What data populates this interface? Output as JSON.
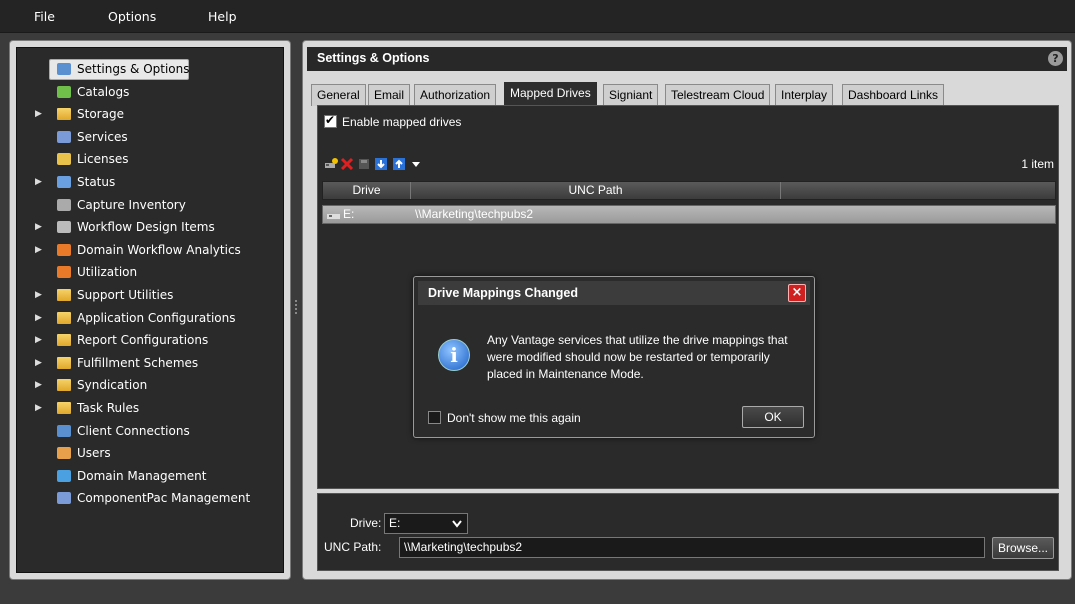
{
  "menubar": {
    "items": [
      {
        "label": "File"
      },
      {
        "label": "Options"
      },
      {
        "label": "Help"
      }
    ]
  },
  "tree": {
    "items": [
      {
        "label": "Settings & Options",
        "icon": "settings-icon",
        "expandable": false,
        "selected": true
      },
      {
        "label": "Catalogs",
        "icon": "catalogs-icon",
        "expandable": false
      },
      {
        "label": "Storage",
        "icon": "folder-icon",
        "expandable": true
      },
      {
        "label": "Services",
        "icon": "services-icon",
        "expandable": false
      },
      {
        "label": "Licenses",
        "icon": "key-icon",
        "expandable": false
      },
      {
        "label": "Status",
        "icon": "status-chart-icon",
        "expandable": true
      },
      {
        "label": "Capture Inventory",
        "icon": "capture-icon",
        "expandable": false
      },
      {
        "label": "Workflow Design Items",
        "icon": "workflow-icon",
        "expandable": true
      },
      {
        "label": "Domain Workflow Analytics",
        "icon": "analytics-icon",
        "expandable": true
      },
      {
        "label": "Utilization",
        "icon": "utilization-icon",
        "expandable": false
      },
      {
        "label": "Support Utilities",
        "icon": "folder-icon",
        "expandable": true
      },
      {
        "label": "Application Configurations",
        "icon": "folder-icon",
        "expandable": true
      },
      {
        "label": "Report Configurations",
        "icon": "folder-icon",
        "expandable": true
      },
      {
        "label": "Fulfillment Schemes",
        "icon": "folder-icon",
        "expandable": true
      },
      {
        "label": "Syndication",
        "icon": "folder-icon",
        "expandable": true
      },
      {
        "label": "Task Rules",
        "icon": "folder-icon",
        "expandable": true
      },
      {
        "label": "Client Connections",
        "icon": "client-icon",
        "expandable": false
      },
      {
        "label": "Users",
        "icon": "users-icon",
        "expandable": false
      },
      {
        "label": "Domain Management",
        "icon": "domain-icon",
        "expandable": false
      },
      {
        "label": "ComponentPac Management",
        "icon": "componentpac-icon",
        "expandable": false
      }
    ]
  },
  "panel": {
    "title": "Settings & Options",
    "help_label": "?"
  },
  "tabs": [
    {
      "label": "General",
      "active": false
    },
    {
      "label": "Email",
      "active": false
    },
    {
      "label": "Authorization",
      "active": false
    },
    {
      "label": "Mapped Drives",
      "active": true
    },
    {
      "label": "Signiant",
      "active": false
    },
    {
      "label": "Telestream Cloud",
      "active": false
    },
    {
      "label": "Interplay",
      "active": false
    },
    {
      "label": "Dashboard Links",
      "active": false
    }
  ],
  "mapped_drives": {
    "enable_label": "Enable mapped drives",
    "enabled": true,
    "item_count": "1 item",
    "columns": [
      "Drive",
      "UNC Path"
    ],
    "rows": [
      {
        "drive": "E:",
        "unc_path": "\\\\Marketing\\techpubs2"
      }
    ]
  },
  "dialog": {
    "title": "Drive Mappings Changed",
    "close_label": "×",
    "info_glyph": "i",
    "message": "Any Vantage services that utilize the drive mappings that were modified should now be restarted or temporarily placed in Maintenance Mode.",
    "dont_show_label": "Don't show me this again",
    "ok_label": "OK"
  },
  "editor": {
    "drive_label": "Drive:",
    "drive_value": "E:",
    "unc_label": "UNC Path:",
    "unc_value": "\\\\Marketing\\techpubs2",
    "browse_label": "Browse..."
  }
}
